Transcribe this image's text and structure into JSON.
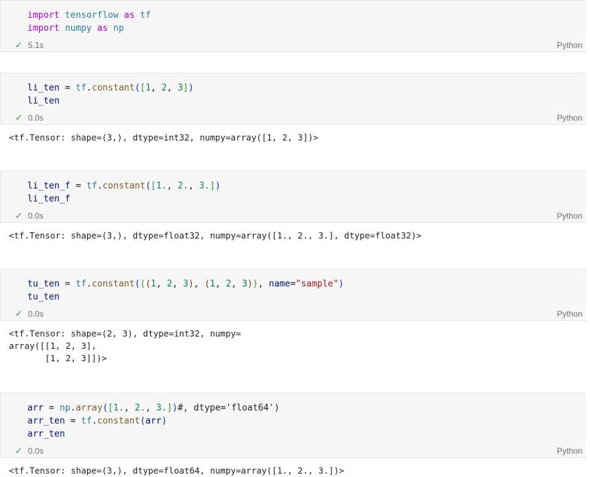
{
  "cells": [
    {
      "code_lines": [
        [
          [
            "kw",
            "import"
          ],
          [
            "plain",
            " "
          ],
          [
            "mod",
            "tensorflow"
          ],
          [
            "plain",
            " "
          ],
          [
            "kw",
            "as"
          ],
          [
            "plain",
            " "
          ],
          [
            "mod",
            "tf"
          ]
        ],
        [
          [
            "kw",
            "import"
          ],
          [
            "plain",
            " "
          ],
          [
            "mod",
            "numpy"
          ],
          [
            "plain",
            " "
          ],
          [
            "kw",
            "as"
          ],
          [
            "plain",
            " "
          ],
          [
            "mod",
            "np"
          ]
        ]
      ],
      "time": "5.1s",
      "language": "Python",
      "output": []
    },
    {
      "code_lines": [
        [
          [
            "id",
            "li_ten"
          ],
          [
            "plain",
            " = "
          ],
          [
            "mod",
            "tf"
          ],
          [
            "plain",
            "."
          ],
          [
            "fn",
            "constant"
          ],
          [
            "paren",
            "("
          ],
          [
            "paren2",
            "["
          ],
          [
            "num",
            "1"
          ],
          [
            "plain",
            ", "
          ],
          [
            "num",
            "2"
          ],
          [
            "plain",
            ", "
          ],
          [
            "num",
            "3"
          ],
          [
            "paren2",
            "]"
          ],
          [
            "paren",
            ")"
          ]
        ],
        [
          [
            "id",
            "li_ten"
          ]
        ]
      ],
      "time": "0.0s",
      "language": "Python",
      "output": [
        "<tf.Tensor: shape=(3,), dtype=int32, numpy=array([1, 2, 3])>"
      ]
    },
    {
      "code_lines": [
        [
          [
            "id",
            "li_ten_f"
          ],
          [
            "plain",
            " = "
          ],
          [
            "mod",
            "tf"
          ],
          [
            "plain",
            "."
          ],
          [
            "fn",
            "constant"
          ],
          [
            "paren",
            "("
          ],
          [
            "paren2",
            "["
          ],
          [
            "num",
            "1."
          ],
          [
            "plain",
            ", "
          ],
          [
            "num",
            "2."
          ],
          [
            "plain",
            ", "
          ],
          [
            "num",
            "3."
          ],
          [
            "paren2",
            "]"
          ],
          [
            "paren",
            ")"
          ]
        ],
        [
          [
            "id",
            "li_ten_f"
          ]
        ]
      ],
      "time": "0.0s",
      "language": "Python",
      "output": [
        "<tf.Tensor: shape=(3,), dtype=float32, numpy=array([1., 2., 3.], dtype=float32)>"
      ]
    },
    {
      "code_lines": [
        [
          [
            "id",
            "tu_ten"
          ],
          [
            "plain",
            " = "
          ],
          [
            "mod",
            "tf"
          ],
          [
            "plain",
            "."
          ],
          [
            "fn",
            "constant"
          ],
          [
            "paren",
            "("
          ],
          [
            "paren2",
            "("
          ],
          [
            "paren3",
            "("
          ],
          [
            "num",
            "1"
          ],
          [
            "plain",
            ", "
          ],
          [
            "num",
            "2"
          ],
          [
            "plain",
            ", "
          ],
          [
            "num",
            "3"
          ],
          [
            "paren3",
            ")"
          ],
          [
            "plain",
            ", "
          ],
          [
            "paren3",
            "("
          ],
          [
            "num",
            "1"
          ],
          [
            "plain",
            ", "
          ],
          [
            "num",
            "2"
          ],
          [
            "plain",
            ", "
          ],
          [
            "num",
            "3"
          ],
          [
            "paren3",
            ")"
          ],
          [
            "paren2",
            ")"
          ],
          [
            "plain",
            ", "
          ],
          [
            "id",
            "name"
          ],
          [
            "plain",
            "="
          ],
          [
            "str",
            "\"sample\""
          ],
          [
            "paren",
            ")"
          ]
        ],
        [
          [
            "id",
            "tu_ten"
          ]
        ]
      ],
      "time": "0.0s",
      "language": "Python",
      "output": [
        "<tf.Tensor: shape=(2, 3), dtype=int32, numpy=",
        "array([[1, 2, 3],",
        "       [1, 2, 3]])>"
      ]
    },
    {
      "code_lines": [
        [
          [
            "id",
            "arr"
          ],
          [
            "plain",
            " = "
          ],
          [
            "mod",
            "np"
          ],
          [
            "plain",
            "."
          ],
          [
            "fn",
            "array"
          ],
          [
            "paren",
            "("
          ],
          [
            "paren2",
            "["
          ],
          [
            "num",
            "1."
          ],
          [
            "plain",
            ", "
          ],
          [
            "num",
            "2."
          ],
          [
            "plain",
            ", "
          ],
          [
            "num",
            "3."
          ],
          [
            "paren2",
            "]"
          ],
          [
            "paren",
            ")"
          ],
          [
            "plain",
            "#, dtype='float64')"
          ]
        ],
        [
          [
            "id",
            "arr_ten"
          ],
          [
            "plain",
            " = "
          ],
          [
            "mod",
            "tf"
          ],
          [
            "plain",
            "."
          ],
          [
            "fn",
            "constant"
          ],
          [
            "paren",
            "("
          ],
          [
            "id",
            "arr"
          ],
          [
            "paren",
            ")"
          ]
        ],
        [
          [
            "id",
            "arr_ten"
          ]
        ]
      ],
      "time": "0.0s",
      "language": "Python",
      "output": [
        "<tf.Tensor: shape=(3,), dtype=float64, numpy=array([1., 2., 3.])>"
      ]
    }
  ],
  "icons": {
    "status": "check-icon"
  }
}
